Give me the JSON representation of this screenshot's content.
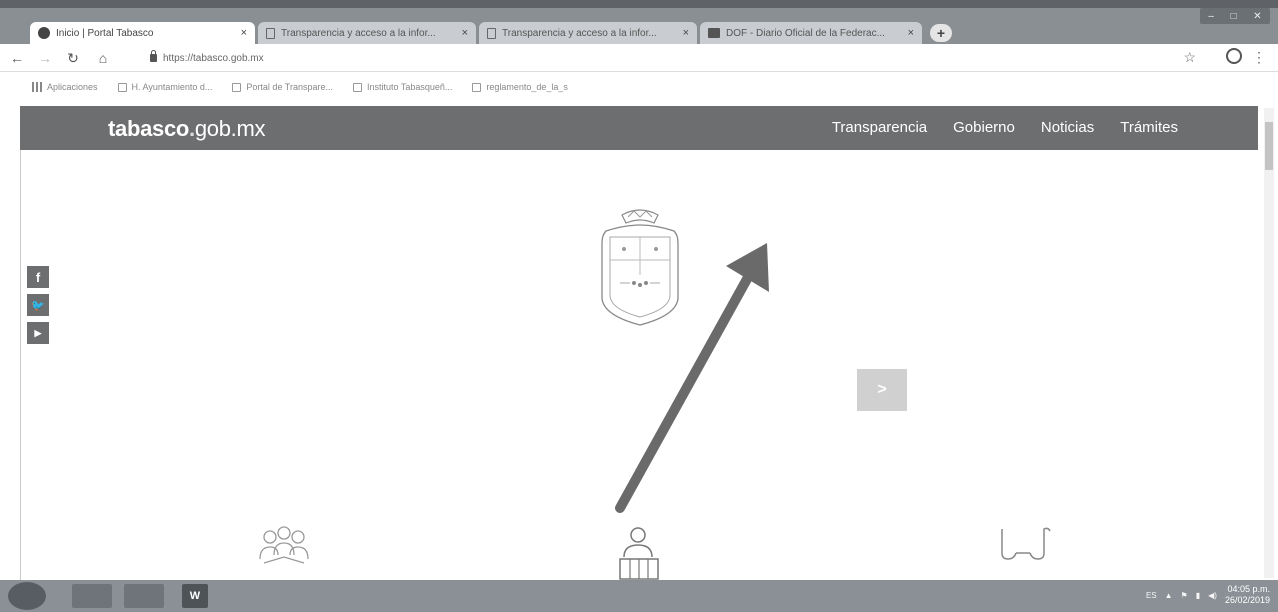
{
  "browser": {
    "tabs": [
      {
        "label": "Inicio | Portal Tabasco",
        "icon": "globe-icon",
        "active": true
      },
      {
        "label": "Transparencia y acceso a la infor...",
        "icon": "page-icon",
        "active": false
      },
      {
        "label": "Transparencia y acceso a la infor...",
        "icon": "page-icon",
        "active": false
      },
      {
        "label": "DOF - Diario Oficial de la Federac...",
        "icon": "dof-icon",
        "active": false
      }
    ],
    "tab_close": "×",
    "new_tab": "+",
    "url": "https://tabasco.gob.mx",
    "bookmarks": [
      {
        "label": "Aplicaciones",
        "icon": "apps-icon"
      },
      {
        "label": "H. Ayuntamiento d...",
        "icon": "bookmark-icon"
      },
      {
        "label": "Portal de Transpare...",
        "icon": "bookmark-icon"
      },
      {
        "label": "Instituto Tabasqueñ...",
        "icon": "bookmark-icon"
      },
      {
        "label": "reglamento_de_la_s",
        "icon": "bookmark-icon"
      }
    ]
  },
  "site": {
    "logo_bold": "tabasco",
    "logo_dot": ".",
    "logo_rest": "gob.mx",
    "nav": [
      "Transparencia",
      "Gobierno",
      "Noticias",
      "Trámites"
    ],
    "social": [
      {
        "icon": "facebook-icon",
        "glyph": "f"
      },
      {
        "icon": "twitter-icon",
        "glyph": "🐦"
      },
      {
        "icon": "youtube-icon",
        "glyph": "▶"
      }
    ],
    "carousel_next": ">"
  },
  "taskbar": {
    "lang": "ES",
    "time": "04:05 p.m.",
    "date": "26/02/2019",
    "word_label": "W"
  },
  "colors": {
    "header_bg": "#6d6e70",
    "annotation_arrow": "#6a6a6a"
  }
}
